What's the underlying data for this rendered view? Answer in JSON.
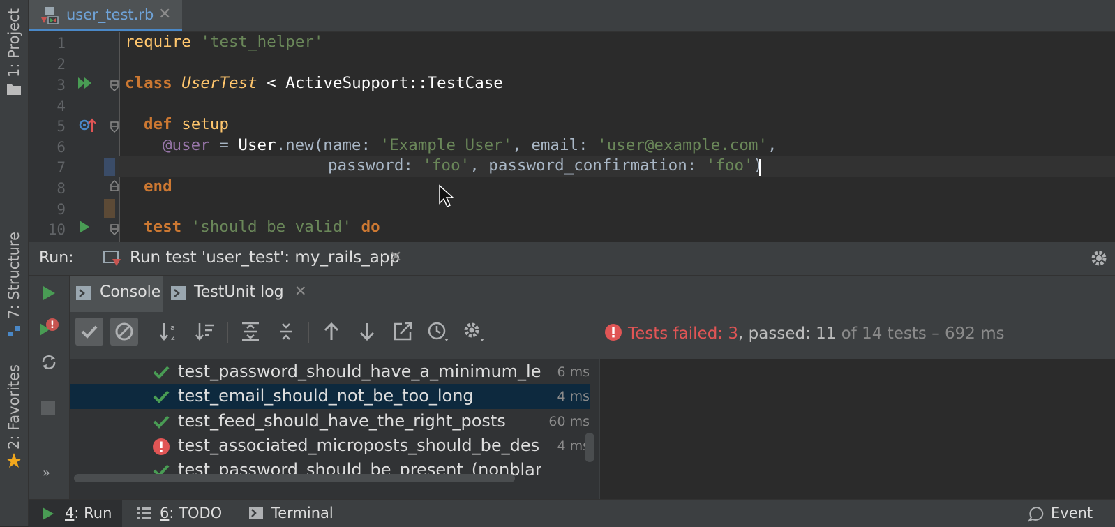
{
  "left_stripe": {
    "project": "1: Project",
    "structure": "7: Structure",
    "favorites": "2: Favorites"
  },
  "editor": {
    "tab_label": "user_test.rb",
    "line_numbers": [
      "1",
      "2",
      "3",
      "4",
      "5",
      "6",
      "7",
      "8",
      "9",
      "10"
    ],
    "lines": {
      "l1_kw": "require",
      "l1_str": "'test_helper'",
      "l3_kw": "class",
      "l3_cls": "UserTest",
      "l3_rest": " < ActiveSupport::TestCase",
      "l5_kw": "def",
      "l5_name": "setup",
      "l6_ivar": "@user",
      "l6_a": " = ",
      "l6_b": "User",
      "l6_c": ".new(name: ",
      "l6_str1": "'Example User'",
      "l6_d": ", email: ",
      "l6_str2": "'user@example.com'",
      "l6_e": ",",
      "l7_a": "password: ",
      "l7_str1": "'foo'",
      "l7_b": ", password_confirmation: ",
      "l7_str2": "'foo'",
      "l7_c": ")",
      "l8_kw": "end",
      "l10_kw": "test",
      "l10_str": "'should be valid'",
      "l10_kw2": "do"
    }
  },
  "run": {
    "label": "Run:",
    "config_tab": "Run test 'user_test': my_rails_app",
    "tabs": [
      "Console",
      "TestUnit log"
    ],
    "status_failed_prefix": "Tests failed: 3",
    "status_passed": ", passed: 11",
    "status_rest": " of 14 tests – 692 ms"
  },
  "tests": [
    {
      "name": "test_password_should_have_a_minimum_le",
      "duration": "6 ms",
      "status": "passed"
    },
    {
      "name": "test_email_should_not_be_too_long",
      "duration": "4 ms",
      "status": "passed"
    },
    {
      "name": "test_feed_should_have_the_right_posts",
      "duration": "60 ms",
      "status": "passed"
    },
    {
      "name": "test_associated_microposts_should_be_des",
      "duration": "4 ms",
      "status": "failed"
    },
    {
      "name": "test_password_should_be_present_(nonblank)",
      "duration": "",
      "status": "passed"
    }
  ],
  "statusbar": {
    "run_num": "4",
    "run_label": ": Run",
    "todo_num": "6",
    "todo_label": ": TODO",
    "terminal": "Terminal",
    "event": "Event"
  },
  "colors": {
    "accent": "#4a88c7",
    "passed": "#499c54",
    "failed": "#e05555",
    "selection": "#0d293e"
  }
}
